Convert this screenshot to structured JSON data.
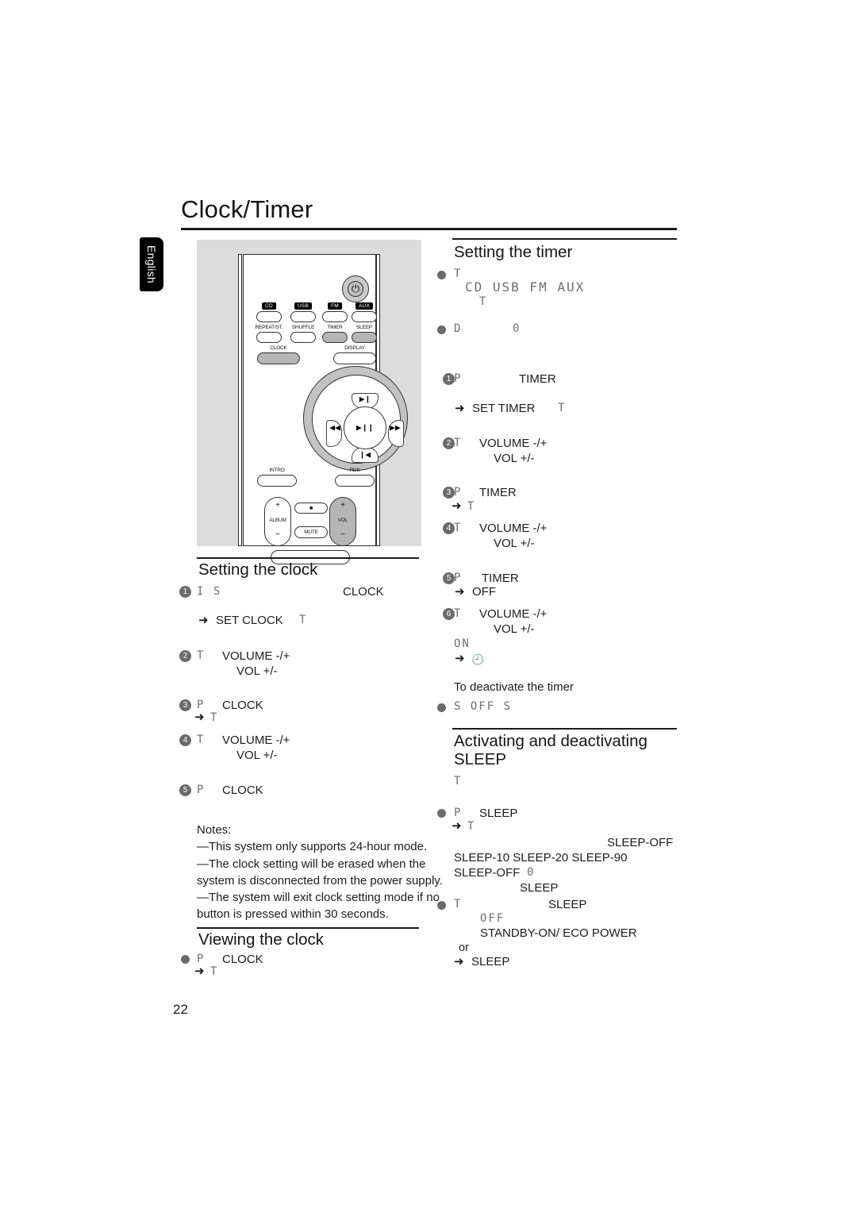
{
  "page": {
    "title": "Clock/Timer",
    "language_tab": "English",
    "page_number": "22"
  },
  "remote": {
    "power_glyph": "⏻",
    "source_buttons": [
      "CD",
      "USB",
      "FM",
      "AUX"
    ],
    "function_buttons": [
      "REPEAT/ST.",
      "SHUFFLE",
      "TIMER",
      "SLEEP"
    ],
    "clock_button": "CLOCK",
    "display_button": "DISPLAY",
    "nav_up_glyph": "▶❙",
    "nav_left_glyph": "◀◀",
    "nav_right_glyph": "▶▶",
    "nav_down_glyph": "❙◀",
    "nav_center_glyph": "▶❙❙",
    "intro_button": "INTRO",
    "rds_button": "RDS",
    "album_label": "ALBUM",
    "album_plus": "+",
    "album_minus": "−",
    "vol_label": "VOL",
    "vol_plus": "+",
    "vol_minus": "−",
    "stop_glyph": "■",
    "mute_button": "MUTE"
  },
  "setting_clock": {
    "heading": "Setting the clock",
    "steps": [
      {
        "num": "1",
        "lcd_prefix": "I S",
        "text": "CLOCK",
        "sub_arrow": "➜",
        "sub_text": "SET CLOCK",
        "sub_lcd": "T"
      },
      {
        "num": "2",
        "lcd_prefix": "T",
        "line1": "VOLUME -/+",
        "line2": "VOL +/-"
      },
      {
        "num": "3",
        "lcd_prefix": "P",
        "text": "CLOCK",
        "sub_arrow": "➜",
        "sub_lcd": "T"
      },
      {
        "num": "4",
        "lcd_prefix": "T",
        "line1": "VOLUME -/+",
        "line2": "VOL +/-"
      },
      {
        "num": "5",
        "lcd_prefix": "P",
        "text": "CLOCK"
      }
    ],
    "notes_label": "Notes:",
    "notes": [
      "—This system only supports 24-hour mode.",
      "—The clock setting will be erased when the system is disconnected from the power supply.",
      "—The system will exit clock setting mode if no button is pressed within 30 seconds."
    ]
  },
  "viewing_clock": {
    "heading": "Viewing the clock",
    "bullet_lcd": "P",
    "bullet_text": "CLOCK",
    "sub_arrow": "➜",
    "sub_lcd": "T"
  },
  "setting_timer": {
    "heading": "Setting the timer",
    "bullets": [
      {
        "lcd": "T",
        "lcd_line2": "CD USB FM AUX",
        "lcd_line3": "T"
      },
      {
        "lcd": "D",
        "lcd_extra": "0"
      }
    ],
    "steps": [
      {
        "num": "1",
        "lcd_prefix": "P",
        "text": "TIMER",
        "sub_arrow": "➜",
        "sub_text": "SET TIMER",
        "sub_lcd": "T"
      },
      {
        "num": "2",
        "lcd_prefix": "T",
        "line1": "VOLUME -/+",
        "line2": "VOL +/-"
      },
      {
        "num": "3",
        "lcd_prefix": "P",
        "text": "TIMER",
        "sub_arrow": "➜",
        "sub_lcd": "T"
      },
      {
        "num": "4",
        "lcd_prefix": "T",
        "line1": "VOLUME -/+",
        "line2": "VOL +/-"
      },
      {
        "num": "5",
        "lcd_prefix": "P",
        "text": "TIMER",
        "sub_arrow": "➜",
        "sub_text": "OFF"
      },
      {
        "num": "6",
        "lcd_prefix": "T",
        "line1": "VOLUME -/+",
        "line2": "VOL +/-",
        "lcd_on": "ON",
        "sub_arrow": "➜",
        "sub_glyph": "🕘"
      }
    ],
    "deactivate_label": "To  deactivate the timer",
    "deactivate_lcd": "S OFF  S"
  },
  "sleep": {
    "heading_line1": "Activating and deactivating",
    "heading_line2": "SLEEP",
    "intro_lcd": "T",
    "bullet1": {
      "lcd_prefix": "P",
      "text": "SLEEP",
      "sub_arrow": "➜",
      "sub_lcd": "T"
    },
    "options_right": "SLEEP-OFF",
    "options_line": "SLEEP-10 SLEEP-20    SLEEP-90",
    "options_off": "SLEEP-OFF",
    "options_off_lcd": "0",
    "options_indent": "SLEEP",
    "bullet2": {
      "lcd_prefix": "T",
      "text": "SLEEP",
      "lcd_off": "OFF",
      "standby_text": "STANDBY-ON/ ECO POWER",
      "or_text": "or",
      "arrow": "➜",
      "arrow_text": "SLEEP"
    }
  }
}
